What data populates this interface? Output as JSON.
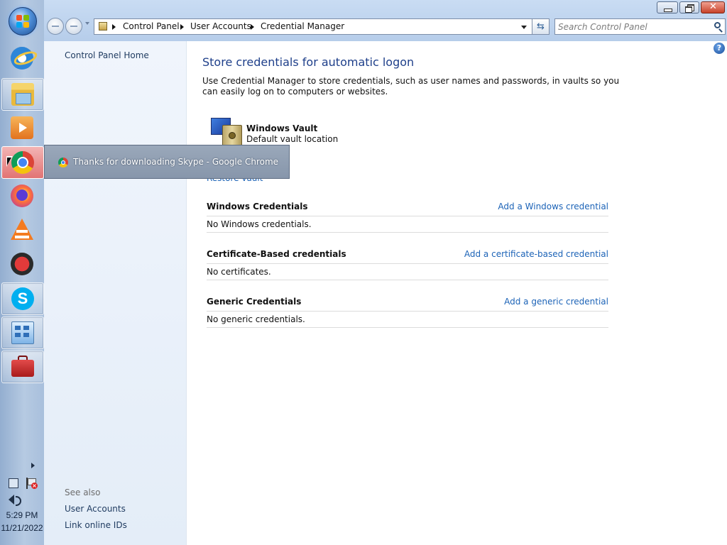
{
  "taskbar": {
    "items": [
      "start",
      "internet-explorer",
      "windows-explorer",
      "media-player",
      "google-chrome",
      "firefox",
      "vlc",
      "red-app",
      "skype",
      "control-panel",
      "toolbox"
    ],
    "clock_time": "5:29 PM",
    "clock_date": "11/21/2022"
  },
  "navigation": {
    "breadcrumbs": [
      "Control Panel",
      "User Accounts",
      "Credential Manager"
    ],
    "search_placeholder": "Search Control Panel"
  },
  "left_pane": {
    "home_link": "Control Panel Home",
    "see_also_label": "See also",
    "see_also_links": [
      "User Accounts",
      "Link online IDs"
    ]
  },
  "content": {
    "title": "Store credentials for automatic logon",
    "description": "Use Credential Manager to store credentials, such as user names and passwords, in vaults so you can easily log on to computers or websites.",
    "vault_name": "Windows Vault",
    "vault_location": "Default vault location",
    "restore_link": "Restore vault",
    "sections": [
      {
        "title": "Windows Credentials",
        "action": "Add a Windows credential",
        "empty_text": "No Windows credentials."
      },
      {
        "title": "Certificate-Based credentials",
        "action": "Add a certificate-based credential",
        "empty_text": "No certificates."
      },
      {
        "title": "Generic Credentials",
        "action": "Add a generic credential",
        "empty_text": "No generic credentials."
      }
    ]
  },
  "tooltip": {
    "text": "Thanks for downloading Skype - Google Chrome"
  },
  "colors": {
    "title_blue": "#1e3f8a",
    "link_blue": "#1c63b7",
    "taskbar": "#a8bfdc",
    "tooltip_bg": "#8f9db1"
  }
}
